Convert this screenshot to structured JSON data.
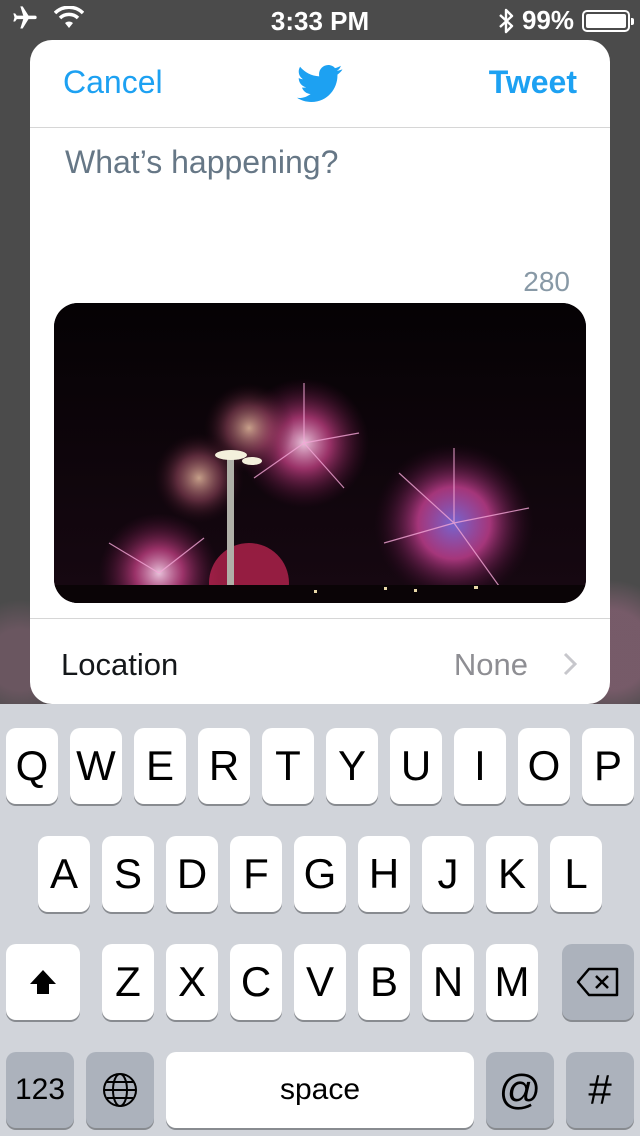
{
  "status_bar": {
    "time": "3:33 PM",
    "battery": "99%",
    "battery_level": 0.99,
    "icons": [
      "airplane-icon",
      "wifi-icon",
      "bluetooth-icon",
      "battery-icon"
    ]
  },
  "compose": {
    "cancel_label": "Cancel",
    "tweet_label": "Tweet",
    "logo_icon": "twitter-bird-icon",
    "placeholder": "What’s happening?",
    "text": "",
    "char_count": "280",
    "photo_description_icon": "fireworks-photo",
    "location_label": "Location",
    "location_value": "None"
  },
  "keyboard": {
    "row1": [
      "Q",
      "W",
      "E",
      "R",
      "T",
      "Y",
      "U",
      "I",
      "O",
      "P"
    ],
    "row2": [
      "A",
      "S",
      "D",
      "F",
      "G",
      "H",
      "J",
      "K",
      "L"
    ],
    "row3": [
      "Z",
      "X",
      "C",
      "V",
      "B",
      "N",
      "M"
    ],
    "numbers_label": "123",
    "space_label": "space",
    "at_label": "@",
    "hash_label": "#"
  },
  "colors": {
    "accent": "#1da1f2",
    "keyboard_bg": "#d1d4da",
    "key_dark": "#acb2bc"
  }
}
